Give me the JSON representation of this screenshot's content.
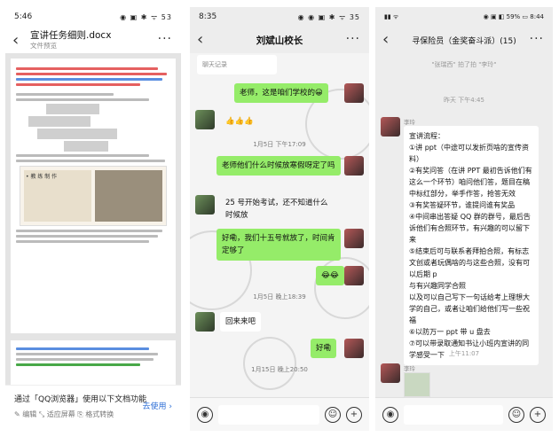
{
  "p1": {
    "time": "5:46",
    "status_icons": "◉ ▣ ✱ ᯤ 53",
    "doc_title": "宣讲任务细则.docx",
    "doc_sub": "文件预览",
    "doc_heading": "• 教 练 制 作",
    "qq_prompt": "通过「QQ浏览器」使用以下文档功能",
    "qq_tools": "✎ 编辑   ⤡ 适应屏幕   ⎘ 格式转换",
    "qq_go": "去使用 ›"
  },
  "p2": {
    "time": "8:35",
    "status_icons": "◉ ◉ ▣ ✱ ᯤ 35",
    "title": "刘斌山校长",
    "top_notice": "聊天记录",
    "m1": "老师，这是咱们学校的😀",
    "m2": "👍👍👍",
    "t1": "1月5日 下午17:09",
    "m3": "老师他们什么时候放寒假呀定了吗",
    "m4": "25 号开始考试，还不知道什么时候放",
    "m5": "好嘞，我们十五号就放了，时间肯定够了",
    "m6": "😂😂",
    "t2": "1月5日 晚上18:39",
    "m7": "回来来吧",
    "m8": "好嘞",
    "t3": "1月15日 晚上20:50"
  },
  "p3": {
    "status_left": "▮▮ ᯤ",
    "status_right": "◉ ▣ ◧ 59% ▭ 8:44",
    "title": "寻保险员（金奖奋斗派）(15)",
    "sys1": "\"张瑞西\" 拍了拍 \"李玲\"",
    "t1": "昨天 下午4:45",
    "sender": "李玲",
    "lines": [
      "宣讲流程：",
      "①讲 ppt（中途可以发折页啥的宣传资料）",
      "②有奖问答（在讲 PPT 最初告诉他们有这么一个环节）咱问他们答，题目在稿中标红部分，举手作答，抢答无效",
      "③有奖答疑环节，谁提问谁有奖品",
      "④中间串出答疑 QQ 群的群号，最后告诉他们有合照环节，有兴趣的可以留下来",
      "⑤结束后可与联系者拜拍合照，有标志文创或者玩偶啥的与这些合照，没有可以后期 p",
      "与有兴趣同学合照",
      "以及可以自己写下一句话给考上理想大学的自己，或者让咱们给他们写一些祝福",
      "⑥以防万一 ppt 带 u 盘去",
      "⑦可以带录取通知书让小班内宣讲的同学感受一下"
    ],
    "t2": "上午11:07",
    "sender2": "李玲"
  }
}
